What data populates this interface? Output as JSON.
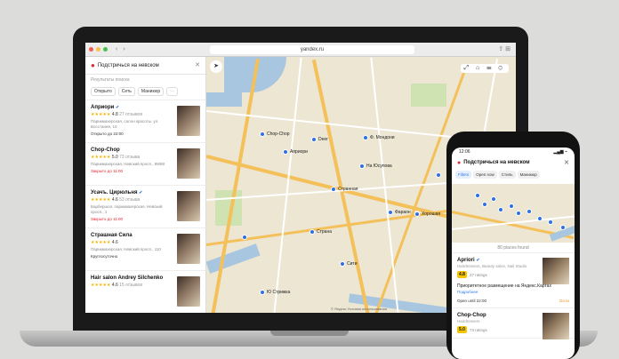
{
  "browser": {
    "url": "yandex.ru"
  },
  "panel": {
    "search_text": "Подстричься на невском",
    "hint": "Результаты поиска",
    "chips": [
      "Открыто",
      "Сеть",
      "Маникюр",
      "···"
    ],
    "cards": [
      {
        "name": "Априори",
        "rating": "4.8",
        "reviews": "27 отзывов",
        "desc": "Парикмахерская, салон красоты. ул. Восстания, 10",
        "status": "Открыто до 22:00",
        "status_color": "#333333"
      },
      {
        "name": "Chop-Chop",
        "rating": "5.0",
        "reviews": "73 отзыва",
        "desc": "Парикмахерская, Невский просп., 89/88",
        "status": "Закрыто до 11:00",
        "status_color": "#e0262e"
      },
      {
        "name": "Усачъ. Цирюльня",
        "rating": "4.6",
        "reviews": "53 отзыва",
        "desc": "Барбершоп, парикмахерская. Невский просп., 1",
        "status": "Закрыто до 11:00",
        "status_color": "#e0262e"
      },
      {
        "name": "Страшная Сила",
        "rating": "4.6",
        "reviews": "",
        "desc": "Парикмахерская, Невский просп., 110",
        "status": "Круглосуточно",
        "status_color": "#333333"
      },
      {
        "name": "Hair salon Andrey Silchenko",
        "rating": "4.6",
        "reviews": "15 отзывов",
        "desc": "",
        "status": "",
        "status_color": "#333333"
      }
    ]
  },
  "map": {
    "labels": [
      "Chop-Chop",
      "Априори",
      "Deer",
      "Ф. Мондони",
      "На Юсупова",
      "Странная",
      "Фараон",
      "Хорошая",
      "Страна",
      "Сити",
      "Ю Стрижка"
    ],
    "tools": "⤢ ⌂ ☰ ⊙",
    "footer": "© Яндекс Условия использования"
  },
  "phone": {
    "time": "12:06",
    "signal": "▂▄▆ ⌁",
    "title": "Подстричься на невском",
    "chips": [
      "Filters",
      "Open now",
      "Стиль",
      "Маникюр"
    ],
    "found": "80 places found",
    "card1": {
      "name": "Apriori",
      "category": "Hairdressers, Beauty salon, Nail Studio",
      "badge": "4.8",
      "reviews": "27 ratings",
      "promo": "Приоритетное размещение на Яндекс.Картах",
      "promo_link": "Подробнее",
      "open": "Open until 22:00",
      "go": "Go to"
    },
    "card2": {
      "name": "Chop-Chop",
      "category": "Hairdressers",
      "badge": "5.0",
      "reviews": "73 ratings"
    }
  }
}
